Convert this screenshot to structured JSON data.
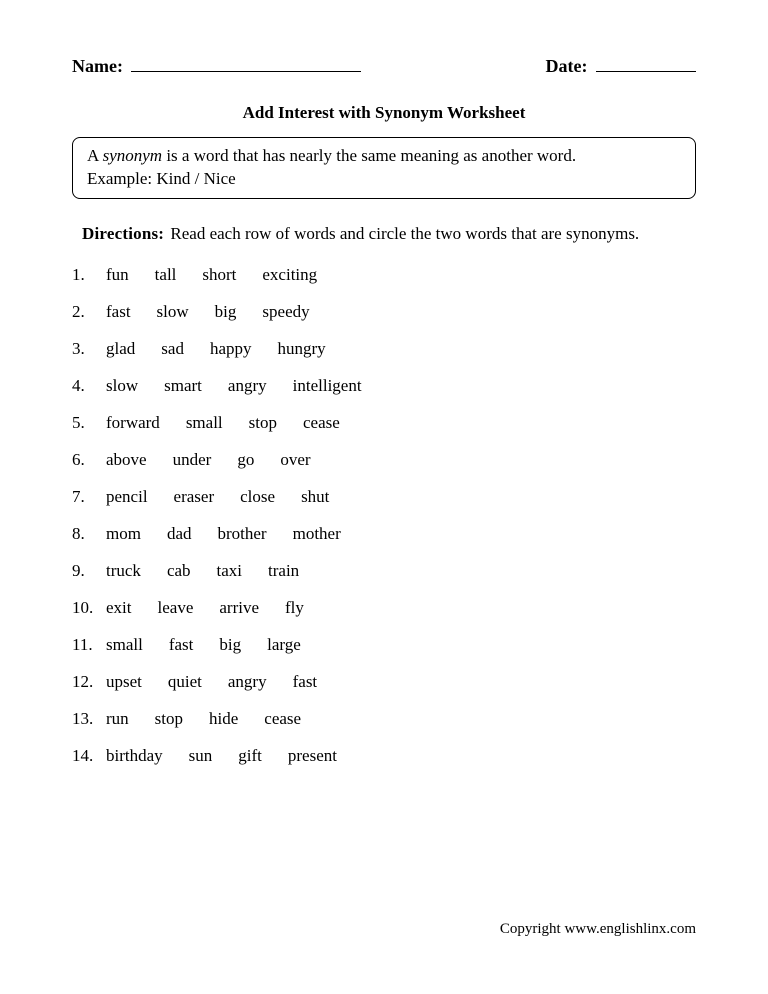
{
  "header": {
    "name_label": "Name:",
    "date_label": "Date:"
  },
  "title": "Add Interest with Synonym Worksheet",
  "definition": {
    "lead": "A ",
    "term": "synonym",
    "rest": " is a word that has nearly the same meaning as another word.",
    "example": "Example: Kind / Nice"
  },
  "directions": {
    "label": "Directions:",
    "text": "Read each row of words and circle the two words that are synonyms."
  },
  "rows": [
    {
      "n": "1.",
      "w": [
        "fun",
        "tall",
        "short",
        "exciting"
      ]
    },
    {
      "n": "2.",
      "w": [
        "fast",
        "slow",
        "big",
        "speedy"
      ]
    },
    {
      "n": "3.",
      "w": [
        "glad",
        "sad",
        "happy",
        "hungry"
      ]
    },
    {
      "n": "4.",
      "w": [
        "slow",
        "smart",
        "angry",
        "intelligent"
      ]
    },
    {
      "n": "5.",
      "w": [
        "forward",
        "small",
        "stop",
        "cease"
      ]
    },
    {
      "n": "6.",
      "w": [
        "above",
        "under",
        "go",
        "over"
      ]
    },
    {
      "n": "7.",
      "w": [
        "pencil",
        "eraser",
        "close",
        "shut"
      ]
    },
    {
      "n": "8.",
      "w": [
        "mom",
        "dad",
        "brother",
        "mother"
      ]
    },
    {
      "n": "9.",
      "w": [
        "truck",
        "cab",
        "taxi",
        "train"
      ]
    },
    {
      "n": "10.",
      "w": [
        "exit",
        "leave",
        "arrive",
        "fly"
      ]
    },
    {
      "n": "11.",
      "w": [
        "small",
        "fast",
        "big",
        "large"
      ]
    },
    {
      "n": "12.",
      "w": [
        "upset",
        "quiet",
        "angry",
        "fast"
      ]
    },
    {
      "n": "13.",
      "w": [
        "run",
        "stop",
        "hide",
        "cease"
      ]
    },
    {
      "n": "14.",
      "w": [
        "birthday",
        "sun",
        "gift",
        "present"
      ]
    }
  ],
  "copyright": "Copyright www.englishlinx.com"
}
